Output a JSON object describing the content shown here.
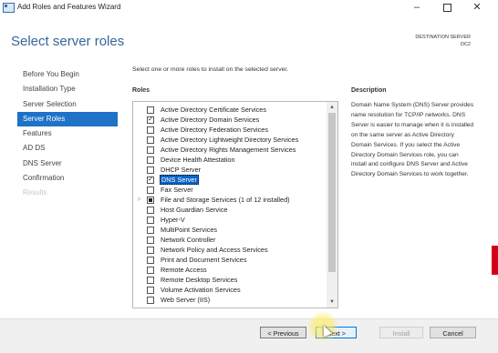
{
  "window": {
    "title": "Add Roles and Features Wizard",
    "minimize_glyph": "–",
    "close_glyph": "✕"
  },
  "header": {
    "page_title": "Select server roles",
    "destination_label": "DESTINATION SERVER",
    "destination_name": "DC2"
  },
  "nav": {
    "items": [
      {
        "label": "Before You Begin",
        "state": "normal"
      },
      {
        "label": "Installation Type",
        "state": "normal"
      },
      {
        "label": "Server Selection",
        "state": "normal"
      },
      {
        "label": "Server Roles",
        "state": "active"
      },
      {
        "label": "Features",
        "state": "normal"
      },
      {
        "label": "AD DS",
        "state": "normal"
      },
      {
        "label": "DNS Server",
        "state": "normal"
      },
      {
        "label": "Confirmation",
        "state": "normal"
      },
      {
        "label": "Results",
        "state": "disabled"
      }
    ]
  },
  "main": {
    "instruction": "Select one or more roles to install on the selected server.",
    "roles_header": "Roles",
    "description_header": "Description",
    "description_text": "Domain Name System (DNS) Server provides name resolution for TCP/IP networks. DNS Server is easier to manage when it is installed on the same server as Active Directory Domain Services. If you select the Active Directory Domain Services role, you can install and configure DNS Server and Active Directory Domain Services to work together.",
    "roles": [
      {
        "label": "Active Directory Certificate Services",
        "state": "unchecked"
      },
      {
        "label": "Active Directory Domain Services",
        "state": "checked"
      },
      {
        "label": "Active Directory Federation Services",
        "state": "unchecked"
      },
      {
        "label": "Active Directory Lightweight Directory Services",
        "state": "unchecked"
      },
      {
        "label": "Active Directory Rights Management Services",
        "state": "unchecked"
      },
      {
        "label": "Device Health Attestation",
        "state": "unchecked"
      },
      {
        "label": "DHCP Server",
        "state": "unchecked"
      },
      {
        "label": "DNS Server",
        "state": "checked",
        "selected": true
      },
      {
        "label": "Fax Server",
        "state": "unchecked"
      },
      {
        "label": "File and Storage Services (1 of 12 installed)",
        "state": "partial",
        "expandable": true
      },
      {
        "label": "Host Guardian Service",
        "state": "unchecked"
      },
      {
        "label": "Hyper-V",
        "state": "unchecked"
      },
      {
        "label": "MultiPoint Services",
        "state": "unchecked"
      },
      {
        "label": "Network Controller",
        "state": "unchecked"
      },
      {
        "label": "Network Policy and Access Services",
        "state": "unchecked"
      },
      {
        "label": "Print and Document Services",
        "state": "unchecked"
      },
      {
        "label": "Remote Access",
        "state": "unchecked"
      },
      {
        "label": "Remote Desktop Services",
        "state": "unchecked"
      },
      {
        "label": "Volume Activation Services",
        "state": "unchecked"
      },
      {
        "label": "Web Server (IIS)",
        "state": "unchecked"
      }
    ]
  },
  "footer": {
    "previous_label": "< Previous",
    "next_label": "Next >",
    "install_label": "Install",
    "cancel_label": "Cancel"
  },
  "colors": {
    "accent": "#1e72c8",
    "title_blue": "#336699",
    "selection": "#0a64c8"
  },
  "icons": {
    "app": "server-manager-icon",
    "check": "✓",
    "expander": "▷"
  }
}
